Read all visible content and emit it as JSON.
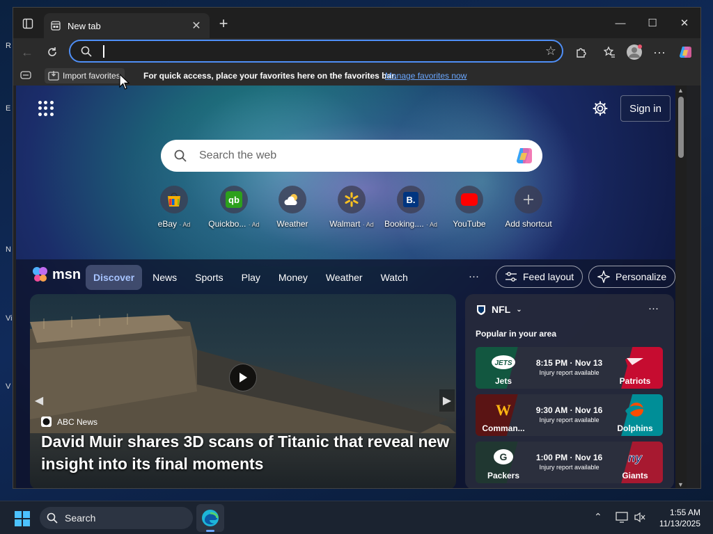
{
  "colors": {
    "accent": "#4f8ff7",
    "link": "#6aa7ff",
    "feed_bg": "#0e142d"
  },
  "browser": {
    "tab_title": "New tab",
    "address_value": "",
    "favorites_bar": {
      "import_label": "Import favorites",
      "message": "For quick access, place your favorites here on the favorites bar.",
      "manage_link": "Manage favorites now"
    }
  },
  "newtab": {
    "signin_label": "Sign in",
    "search_placeholder": "Search the web",
    "shortcuts": [
      {
        "label": "eBay",
        "ad": "· Ad",
        "icon": "ebay-icon"
      },
      {
        "label": "Quickbo...",
        "ad": "· Ad",
        "icon": "quickbooks-icon"
      },
      {
        "label": "Weather",
        "ad": "",
        "icon": "weather-icon"
      },
      {
        "label": "Walmart",
        "ad": "· Ad",
        "icon": "walmart-icon"
      },
      {
        "label": "Booking....",
        "ad": "· Ad",
        "icon": "booking-icon"
      },
      {
        "label": "YouTube",
        "ad": "",
        "icon": "youtube-icon"
      },
      {
        "label": "Add shortcut",
        "ad": "",
        "icon": "plus-icon"
      }
    ]
  },
  "feed": {
    "logo": "msn",
    "nav": [
      "Discover",
      "News",
      "Sports",
      "Play",
      "Money",
      "Weather",
      "Watch"
    ],
    "more": "···",
    "feed_layout_label": "Feed layout",
    "personalize_label": "Personalize",
    "hero": {
      "source": "ABC News",
      "headline": "David Muir shares 3D scans of Titanic that reveal new insight into its final moments"
    },
    "nfl": {
      "title": "NFL",
      "more": "···",
      "subtitle": "Popular in your area",
      "games": [
        {
          "home": "Jets",
          "away": "Patriots",
          "time": "8:15 PM · Nov 13",
          "note": "Injury report available",
          "home_color": "#125740",
          "away_color": "#c60c30"
        },
        {
          "home": "Comman...",
          "away": "Dolphins",
          "time": "9:30 AM · Nov 16",
          "note": "Injury report available",
          "home_color": "#5a1414",
          "away_color": "#008e97"
        },
        {
          "home": "Packers",
          "away": "Giants",
          "time": "1:00 PM · Nov 16",
          "note": "Injury report available",
          "home_color": "#203731",
          "away_color": "#a71930"
        }
      ]
    }
  },
  "taskbar": {
    "search_label": "Search",
    "time": "1:55 AM",
    "date": "11/13/2025"
  }
}
